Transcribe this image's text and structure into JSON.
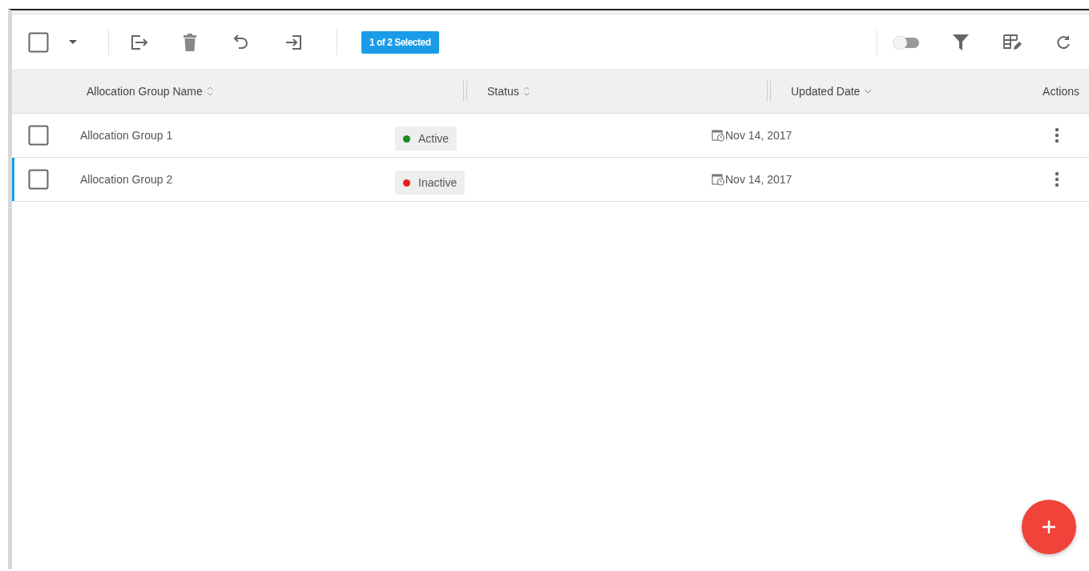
{
  "toolbar": {
    "select_all_checked": false,
    "selection_badge": "1 of 2 Selected",
    "toggle_on": false
  },
  "table": {
    "columns": [
      {
        "label": "Allocation Group Name",
        "kind": "sortable"
      },
      {
        "label": "Status",
        "kind": "sortable"
      },
      {
        "label": "Updated Date",
        "kind": "descending"
      },
      {
        "label": "Actions",
        "kind": "plain"
      }
    ],
    "rows": [
      {
        "name": "Allocation Group 1",
        "status": "Active",
        "color": "#1a8a1a",
        "date": "Nov 14, 2017",
        "checked": false,
        "selected": false
      },
      {
        "name": "Allocation Group 2",
        "status": "Inactive",
        "color": "#e8201a",
        "date": "Nov 14, 2017",
        "checked": false,
        "selected": true
      }
    ]
  }
}
